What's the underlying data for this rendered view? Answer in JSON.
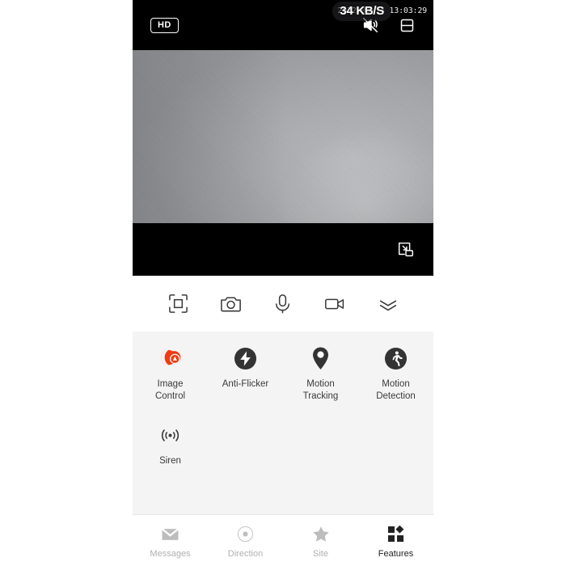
{
  "player": {
    "quality_badge": "HD",
    "mute_icon": "speaker-muted-icon",
    "layout_icon": "split-screen-icon",
    "pip_icon": "picture-in-picture-icon",
    "osd_timestamp": "2022-03-14 13:03:29",
    "osd_timestamp_prefix": "2022-",
    "osd_timestamp_suffix": "03:29",
    "bandwidth": "34 KB/S"
  },
  "controls": [
    {
      "name": "fullscreen-frame-icon",
      "label": "Fullscreen"
    },
    {
      "name": "camera-icon",
      "label": "Snapshot"
    },
    {
      "name": "microphone-icon",
      "label": "Talk"
    },
    {
      "name": "video-camera-icon",
      "label": "Record"
    },
    {
      "name": "collapse-chevron-icon",
      "label": "Collapse"
    }
  ],
  "features": {
    "row1": [
      {
        "label": "Image Control",
        "icon": "image-control-icon",
        "color": "#ef3b12"
      },
      {
        "label": "Anti-Flicker",
        "icon": "anti-flicker-icon",
        "color": "#333333"
      },
      {
        "label": "Motion Tracking",
        "icon": "motion-tracking-icon",
        "color": "#333333"
      },
      {
        "label": "Motion Detection",
        "icon": "motion-detection-icon",
        "color": "#333333"
      }
    ],
    "row2": [
      {
        "label": "Siren",
        "icon": "siren-icon",
        "color": "#333333"
      }
    ]
  },
  "bottom_nav": [
    {
      "label": "Messages",
      "icon": "envelope-icon",
      "active": false
    },
    {
      "label": "Direction",
      "icon": "direction-pad-icon",
      "active": false
    },
    {
      "label": "Site",
      "icon": "star-icon",
      "active": false
    },
    {
      "label": "Features",
      "icon": "grid-icon",
      "active": true
    }
  ],
  "colors": {
    "accent": "#ef3b12",
    "panel_bg": "#f4f4f4",
    "nav_inactive": "#b0b0b0",
    "nav_active": "#222222"
  }
}
